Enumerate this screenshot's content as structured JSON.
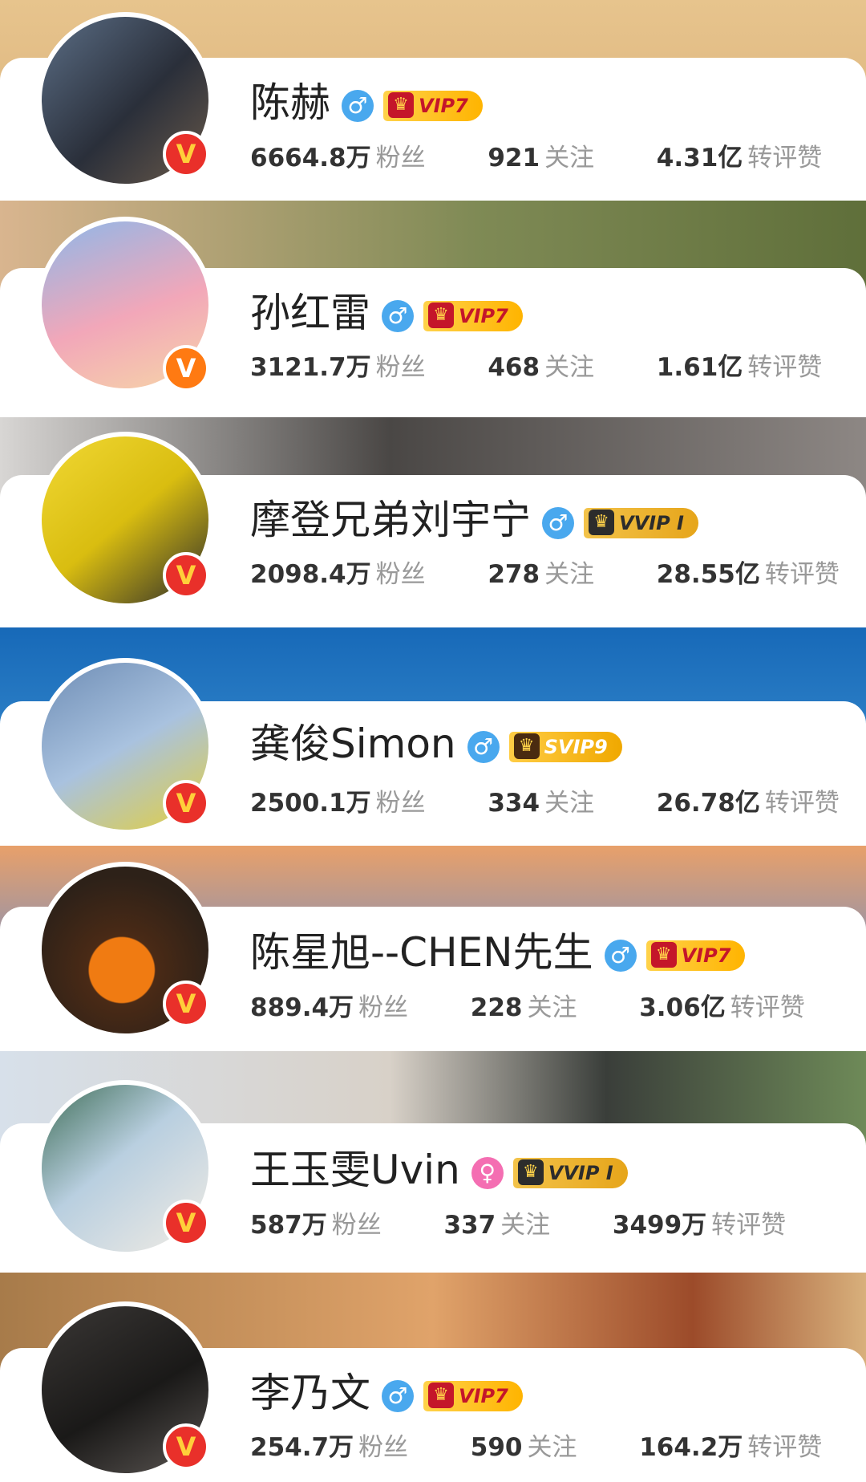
{
  "users": [
    {
      "name": "陈赫",
      "gender": "♂",
      "gender_type": "male",
      "vip": "VIP7",
      "vip_type": "vip",
      "fans": "6664.8万",
      "fans_label": "粉丝",
      "follow": "921",
      "follow_label": "关注",
      "likes": "4.31亿",
      "likes_label": "转评赞",
      "badge": "V",
      "badge_color": "#e9302a"
    },
    {
      "name": "孙红雷",
      "gender": "♂",
      "gender_type": "male",
      "vip": "VIP7",
      "vip_type": "vip",
      "fans": "3121.7万",
      "fans_label": "粉丝",
      "follow": "468",
      "follow_label": "关注",
      "likes": "1.61亿",
      "likes_label": "转评赞",
      "badge": "V",
      "badge_color": "#ff7a12"
    },
    {
      "name": "摩登兄弟刘宇宁",
      "gender": "♂",
      "gender_type": "male",
      "vip": "VVIP I",
      "vip_type": "vvip",
      "fans": "2098.4万",
      "fans_label": "粉丝",
      "follow": "278",
      "follow_label": "关注",
      "likes": "28.55亿",
      "likes_label": "转评赞",
      "badge": "V",
      "badge_color": "#e9302a"
    },
    {
      "name": "龚俊Simon",
      "gender": "♂",
      "gender_type": "male",
      "vip": "SVIP9",
      "vip_type": "svip",
      "fans": "2500.1万",
      "fans_label": "粉丝",
      "follow": "334",
      "follow_label": "关注",
      "likes": "26.78亿",
      "likes_label": "转评赞",
      "badge": "V",
      "badge_color": "#e9302a"
    },
    {
      "name": "陈星旭--CHEN先生",
      "gender": "♂",
      "gender_type": "male",
      "vip": "VIP7",
      "vip_type": "vip",
      "fans": "889.4万",
      "fans_label": "粉丝",
      "follow": "228",
      "follow_label": "关注",
      "likes": "3.06亿",
      "likes_label": "转评赞",
      "badge": "V",
      "badge_color": "#e9302a"
    },
    {
      "name": "王玉雯Uvin",
      "gender": "♀",
      "gender_type": "female",
      "vip": "VVIP I",
      "vip_type": "vvip",
      "fans": "587万",
      "fans_label": "粉丝",
      "follow": "337",
      "follow_label": "关注",
      "likes": "3499万",
      "likes_label": "转评赞",
      "badge": "V",
      "badge_color": "#e9302a"
    },
    {
      "name": "李乃文",
      "gender": "♂",
      "gender_type": "male",
      "vip": "VIP7",
      "vip_type": "vip",
      "fans": "254.7万",
      "fans_label": "粉丝",
      "follow": "590",
      "follow_label": "关注",
      "likes": "164.2万",
      "likes_label": "转评赞",
      "badge": "V",
      "badge_color": "#e9302a"
    }
  ]
}
